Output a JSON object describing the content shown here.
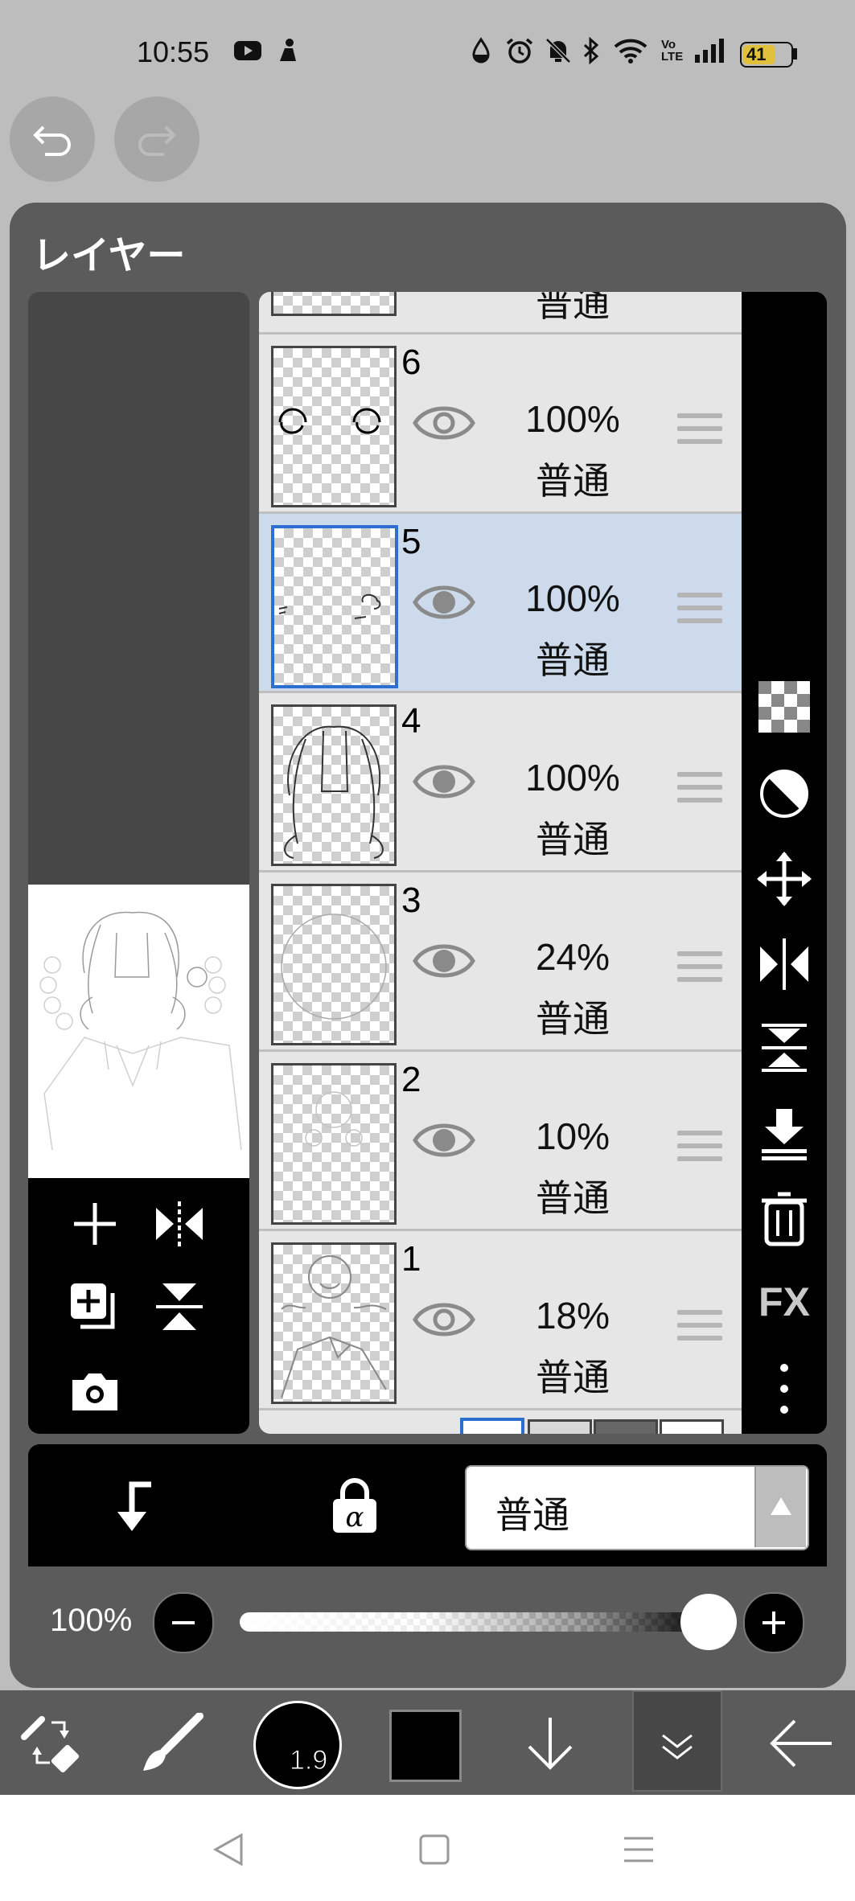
{
  "status_bar": {
    "time": "10:55",
    "battery": "41",
    "icons": [
      "youtube-icon",
      "app-icon",
      "drop-icon",
      "alarm-icon",
      "mute-icon",
      "bluetooth-icon",
      "wifi-icon",
      "volte-icon",
      "signal-icon",
      "battery-icon"
    ],
    "volte_label": "Vo LTE"
  },
  "header": {
    "undo_icon": "undo-icon",
    "redo_icon": "redo-icon"
  },
  "panel": {
    "title": "レイヤー"
  },
  "layers": [
    {
      "number": "6",
      "opacity": "100%",
      "blend": "普通",
      "visible": true,
      "selected": false
    },
    {
      "number": "5",
      "opacity": "100%",
      "blend": "普通",
      "visible": true,
      "selected": true
    },
    {
      "number": "4",
      "opacity": "100%",
      "blend": "普通",
      "visible": true,
      "selected": false
    },
    {
      "number": "3",
      "opacity": "24%",
      "blend": "普通",
      "visible": true,
      "selected": false
    },
    {
      "number": "2",
      "opacity": "10%",
      "blend": "普通",
      "visible": true,
      "selected": false
    },
    {
      "number": "1",
      "opacity": "18%",
      "blend": "普通",
      "visible": true,
      "selected": false
    }
  ],
  "top_partial_layer": {
    "blend": "普通"
  },
  "right_toolbar": {
    "fx_label": "FX"
  },
  "controls": {
    "blend_mode": "普通",
    "opacity_label": "100%",
    "opacity_value": 1.0
  },
  "bottom_toolbar": {
    "brush_size": "1.9",
    "color": "#000000"
  },
  "colors": {
    "selected_row": "#ccdaeb",
    "selected_border": "#2c6fd1",
    "panel": "#5b5b5b"
  }
}
